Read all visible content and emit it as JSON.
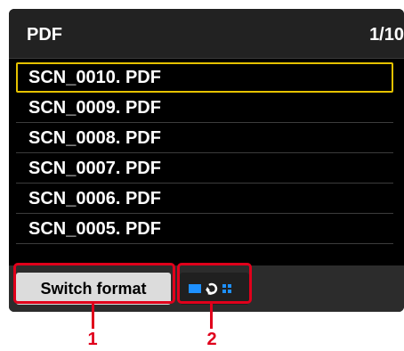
{
  "header": {
    "title": "PDF",
    "page_indicator": "1/10"
  },
  "files": [
    {
      "name": "SCN_0010. PDF",
      "selected": true
    },
    {
      "name": "SCN_0009. PDF",
      "selected": false
    },
    {
      "name": "SCN_0008. PDF",
      "selected": false
    },
    {
      "name": "SCN_0007. PDF",
      "selected": false
    },
    {
      "name": "SCN_0006. PDF",
      "selected": false
    },
    {
      "name": "SCN_0005. PDF",
      "selected": false
    }
  ],
  "footer": {
    "switch_format_label": "Switch format",
    "view_toggle_icon": "list-grid-toggle-icon"
  },
  "callouts": {
    "one": "1",
    "two": "2"
  },
  "colors": {
    "selection": "#e6c200",
    "callout": "#e0001b",
    "view_icon": "#1e90ff"
  }
}
